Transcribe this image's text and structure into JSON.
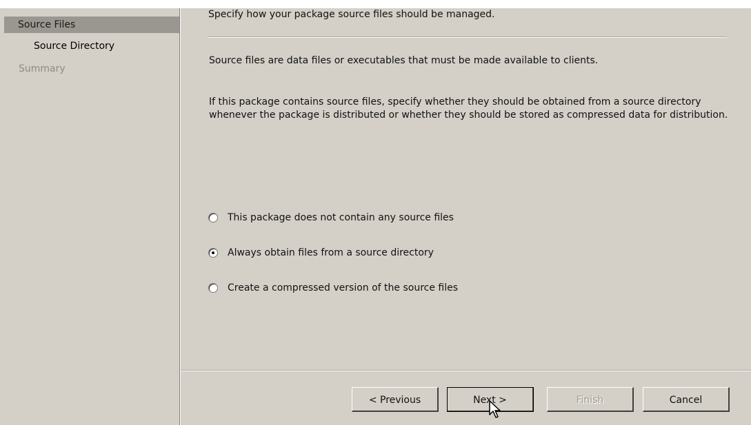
{
  "nav": {
    "items": [
      {
        "label": "Source Files"
      },
      {
        "label": "Source Directory"
      },
      {
        "label": "Summary"
      }
    ]
  },
  "content": {
    "heading": "Specify how your package source files should be managed.",
    "paragraph1": "Source files are data files or executables that must be made available to clients.",
    "paragraph2": "If this package contains source files, specify whether they should be obtained from a source directory whenever the package is distributed or whether they should be stored as compressed data for distribution."
  },
  "options": [
    {
      "label": "This package does not contain any source files",
      "selected": false
    },
    {
      "label": "Always obtain files from a source directory",
      "selected": true
    },
    {
      "label": "Create a compressed version of the source files",
      "selected": false
    }
  ],
  "buttons": {
    "previous": "< Previous",
    "next": "Next >",
    "finish": "Finish",
    "cancel": "Cancel"
  },
  "colors": {
    "dialog_bg": "#d4d0c8",
    "active_nav": "#9a9690",
    "disabled_text": "#8c8a85"
  },
  "cursor_icon": "arrow-pointer-icon"
}
